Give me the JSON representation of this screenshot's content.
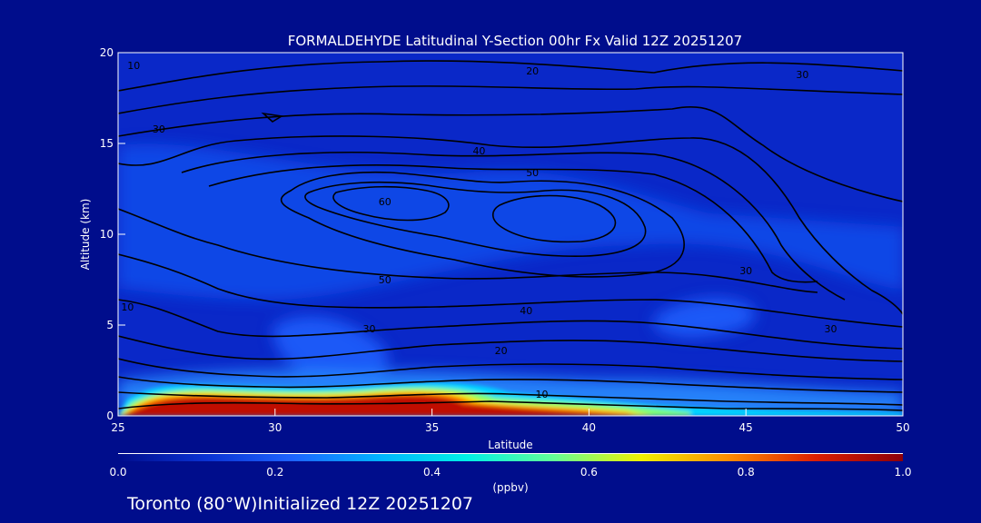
{
  "chart_data": {
    "type": "heatmap",
    "title": "FORMALDEHYDE Latitudinal Y-Section 00hr  Fx Valid 12Z 20251207",
    "xlabel": "Latitude",
    "ylabel": "Altitude (km)",
    "xlim": [
      25,
      50
    ],
    "ylim": [
      0,
      20
    ],
    "x_ticks": [
      25,
      30,
      35,
      40,
      45,
      50
    ],
    "y_ticks": [
      0,
      5,
      10,
      15,
      20
    ],
    "grid": false,
    "colorbar": {
      "label": "(ppbv)",
      "range": [
        0.0,
        1.0
      ],
      "ticks": [
        "0.0",
        "0.2",
        "0.4",
        "0.6",
        "0.8",
        "1.0"
      ],
      "colors": [
        "#000d8c",
        "#0a32d2",
        "#1e64ff",
        "#00b4ff",
        "#00f0e6",
        "#64ff96",
        "#f0f000",
        "#ff8c00",
        "#dc1e00",
        "#8c000a"
      ]
    },
    "field_highlights": [
      {
        "lat": 29.5,
        "alt": 0.4,
        "value": 1.0
      },
      {
        "lat": 35.0,
        "alt": 0.6,
        "value": 0.95
      },
      {
        "lat": 40.0,
        "alt": 0.4,
        "value": 0.9
      },
      {
        "lat": 32.0,
        "alt": 3.5,
        "value": 0.3
      },
      {
        "lat": 44.0,
        "alt": 5.5,
        "value": 0.3
      },
      {
        "lat": 34.0,
        "alt": 13.0,
        "value": 0.2
      }
    ],
    "contour_labels": [
      {
        "text": "10",
        "lat": 25.5,
        "alt": 19.3
      },
      {
        "text": "20",
        "lat": 38.2,
        "alt": 19.0
      },
      {
        "text": "30",
        "lat": 46.8,
        "alt": 18.8
      },
      {
        "text": "30",
        "lat": 26.3,
        "alt": 15.8
      },
      {
        "text": "40",
        "lat": 36.5,
        "alt": 14.6
      },
      {
        "text": "50",
        "lat": 38.2,
        "alt": 13.4
      },
      {
        "text": "60",
        "lat": 33.5,
        "alt": 11.8
      },
      {
        "text": "50",
        "lat": 33.5,
        "alt": 7.5
      },
      {
        "text": "40",
        "lat": 38.0,
        "alt": 5.8
      },
      {
        "text": "30",
        "lat": 33.0,
        "alt": 4.8
      },
      {
        "text": "20",
        "lat": 37.2,
        "alt": 3.6
      },
      {
        "text": "10",
        "lat": 38.5,
        "alt": 1.2
      },
      {
        "text": "30",
        "lat": 45.0,
        "alt": 8.0
      },
      {
        "text": "30",
        "lat": 47.7,
        "alt": 4.8
      },
      {
        "text": "10",
        "lat": 25.3,
        "alt": 6.0
      }
    ]
  },
  "footer": {
    "text": "Toronto (80°W)Initialized 12Z 20251207"
  }
}
